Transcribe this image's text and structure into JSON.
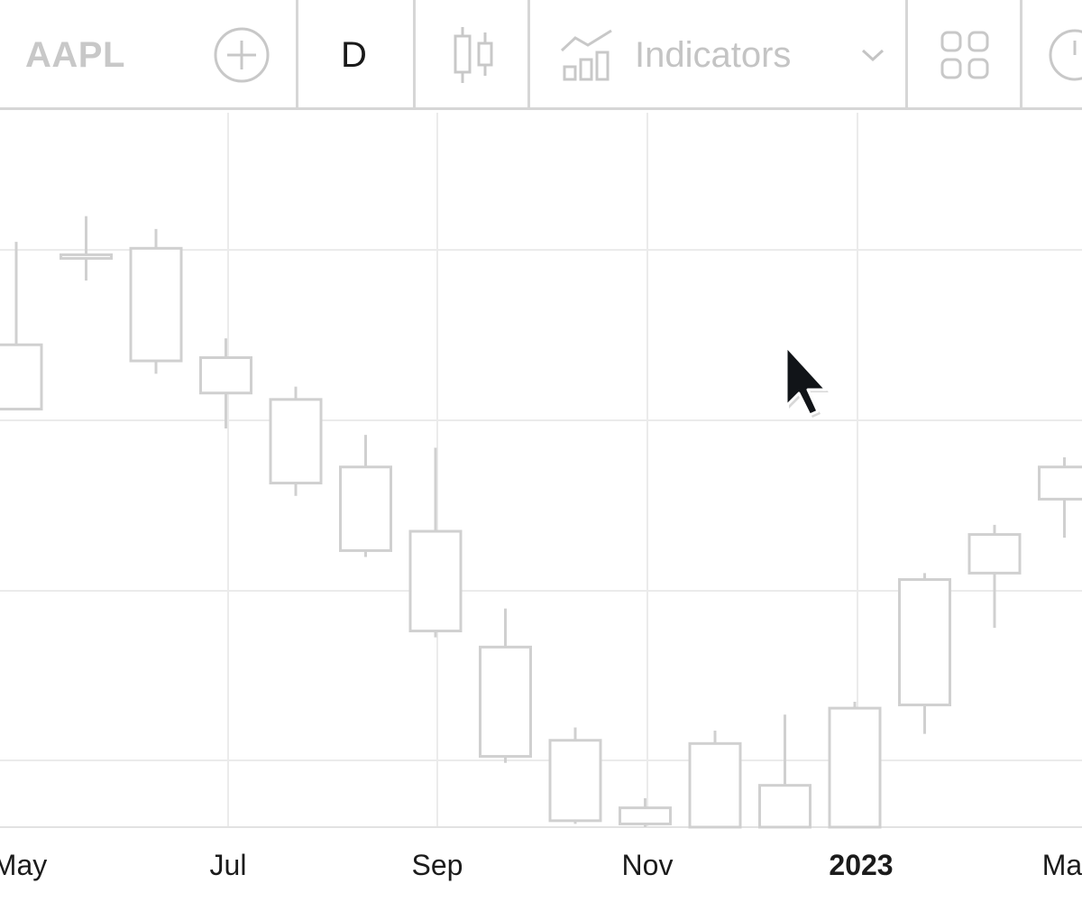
{
  "toolbar": {
    "symbol": "AAPL",
    "interval": "D",
    "indicators_label": "Indicators",
    "icons": [
      "plus-circle-icon",
      "candlestick-icon",
      "indicators-chart-icon",
      "chevron-down-icon",
      "layout-grid-icon",
      "clock-icon"
    ]
  },
  "colors": {
    "text": "#1b1b1b",
    "muted": "#c8c8c8",
    "grid": "#ebebeb",
    "candle": "#d0d0d0"
  },
  "chart_data": {
    "type": "candlestick",
    "x_labels": [
      "May",
      "Jul",
      "Sep",
      "Nov",
      "2023",
      "Ma"
    ],
    "bold_labels": [
      "2023"
    ],
    "ylim": [
      0,
      100
    ],
    "grid": true,
    "candles": [
      {
        "open": 65.0,
        "close": 75.0,
        "high": 91.0,
        "low": 69.0
      },
      {
        "open": 88.5,
        "close": 89.0,
        "high": 95.0,
        "low": 85.0
      },
      {
        "open": 72.5,
        "close": 90.0,
        "high": 93.0,
        "low": 70.5
      },
      {
        "open": 67.5,
        "close": 73.0,
        "high": 76.0,
        "low": 62.0
      },
      {
        "open": 53.5,
        "close": 66.5,
        "high": 68.5,
        "low": 51.5
      },
      {
        "open": 43.0,
        "close": 56.0,
        "high": 61.0,
        "low": 42.0
      },
      {
        "open": 30.5,
        "close": 46.0,
        "high": 59.0,
        "low": 29.5
      },
      {
        "open": 11.0,
        "close": 28.0,
        "high": 34.0,
        "low": 10.0
      },
      {
        "open": 1.0,
        "close": 13.5,
        "high": 15.5,
        "low": 0.5
      },
      {
        "open": 0.5,
        "close": 3.0,
        "high": 4.5,
        "low": 0.0
      },
      {
        "open": 0.0,
        "close": 13.0,
        "high": 15.0,
        "low": 0.0
      },
      {
        "open": 0.0,
        "close": 6.5,
        "high": 17.5,
        "low": 0.0
      },
      {
        "open": 0.0,
        "close": 18.5,
        "high": 19.5,
        "low": 0.0
      },
      {
        "open": 19.0,
        "close": 38.5,
        "high": 39.5,
        "low": 14.5
      },
      {
        "open": 39.5,
        "close": 45.5,
        "high": 47.0,
        "low": 31.0
      },
      {
        "open": 51.0,
        "close": 56.0,
        "high": 57.5,
        "low": 45.0
      }
    ]
  }
}
